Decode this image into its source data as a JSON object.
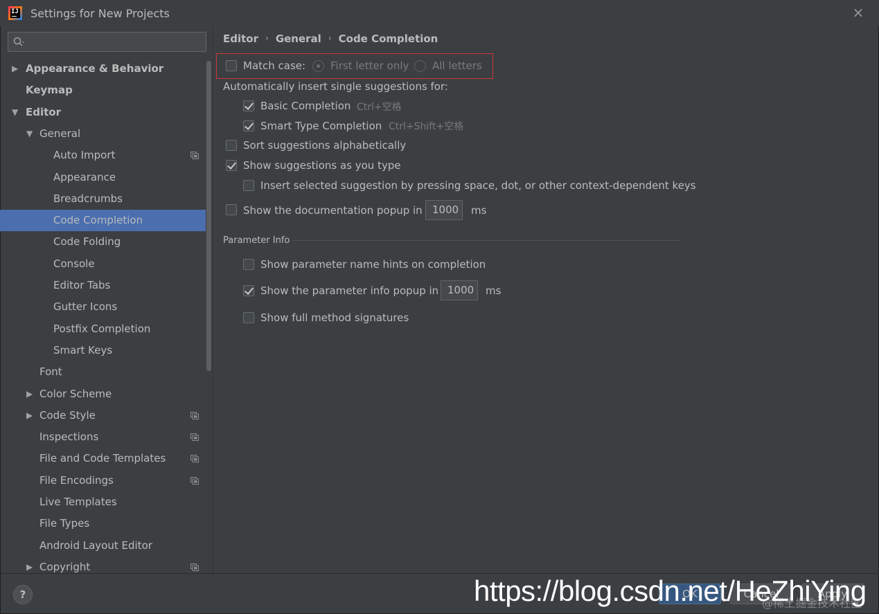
{
  "window": {
    "title": "Settings for New Projects",
    "close_icon": "×"
  },
  "search": {
    "placeholder": ""
  },
  "tree": [
    {
      "label": "Appearance & Behavior",
      "bold": true,
      "arrow": "▶",
      "indent": 0
    },
    {
      "label": "Keymap",
      "bold": true,
      "arrow": "",
      "indent": 0
    },
    {
      "label": "Editor",
      "bold": true,
      "arrow": "▼",
      "indent": 0
    },
    {
      "label": "General",
      "bold": false,
      "arrow": "▼",
      "indent": 1
    },
    {
      "label": "Auto Import",
      "bold": false,
      "arrow": "",
      "indent": 2,
      "project_icon": true
    },
    {
      "label": "Appearance",
      "bold": false,
      "arrow": "",
      "indent": 2
    },
    {
      "label": "Breadcrumbs",
      "bold": false,
      "arrow": "",
      "indent": 2
    },
    {
      "label": "Code Completion",
      "bold": false,
      "arrow": "",
      "indent": 2,
      "selected": true
    },
    {
      "label": "Code Folding",
      "bold": false,
      "arrow": "",
      "indent": 2
    },
    {
      "label": "Console",
      "bold": false,
      "arrow": "",
      "indent": 2
    },
    {
      "label": "Editor Tabs",
      "bold": false,
      "arrow": "",
      "indent": 2
    },
    {
      "label": "Gutter Icons",
      "bold": false,
      "arrow": "",
      "indent": 2
    },
    {
      "label": "Postfix Completion",
      "bold": false,
      "arrow": "",
      "indent": 2
    },
    {
      "label": "Smart Keys",
      "bold": false,
      "arrow": "",
      "indent": 2
    },
    {
      "label": "Font",
      "bold": false,
      "arrow": "",
      "indent": 1
    },
    {
      "label": "Color Scheme",
      "bold": false,
      "arrow": "▶",
      "indent": 1
    },
    {
      "label": "Code Style",
      "bold": false,
      "arrow": "▶",
      "indent": 1,
      "project_icon": true
    },
    {
      "label": "Inspections",
      "bold": false,
      "arrow": "",
      "indent": 1,
      "project_icon": true
    },
    {
      "label": "File and Code Templates",
      "bold": false,
      "arrow": "",
      "indent": 1,
      "project_icon": true
    },
    {
      "label": "File Encodings",
      "bold": false,
      "arrow": "",
      "indent": 1,
      "project_icon": true
    },
    {
      "label": "Live Templates",
      "bold": false,
      "arrow": "",
      "indent": 1
    },
    {
      "label": "File Types",
      "bold": false,
      "arrow": "",
      "indent": 1
    },
    {
      "label": "Android Layout Editor",
      "bold": false,
      "arrow": "",
      "indent": 1
    },
    {
      "label": "Copyright",
      "bold": false,
      "arrow": "▶",
      "indent": 1,
      "project_icon": true
    }
  ],
  "breadcrumb": {
    "items": [
      "Editor",
      "General",
      "Code Completion"
    ],
    "separator": "›"
  },
  "match_case": {
    "label": "Match case:",
    "checked": false,
    "radio_first": "First letter only",
    "radio_all": "All letters",
    "selected": "first"
  },
  "auto_insert": {
    "heading": "Automatically insert single suggestions for:",
    "basic": {
      "label": "Basic Completion",
      "shortcut": "Ctrl+空格",
      "checked": true
    },
    "smart": {
      "label": "Smart Type Completion",
      "shortcut": "Ctrl+Shift+空格",
      "checked": true
    }
  },
  "options": {
    "sort_alpha": {
      "label": "Sort suggestions alphabetically",
      "checked": false
    },
    "show_as_type": {
      "label": "Show suggestions as you type",
      "checked": true
    },
    "insert_selected": {
      "label": "Insert selected suggestion by pressing space, dot, or other context-dependent keys",
      "checked": false
    },
    "doc_popup": {
      "label": "Show the documentation popup in",
      "value": "1000",
      "unit": "ms",
      "checked": false
    }
  },
  "parameter_info": {
    "title": "Parameter Info",
    "name_hints": {
      "label": "Show parameter name hints on completion",
      "checked": false
    },
    "info_popup": {
      "label": "Show the parameter info popup in",
      "value": "1000",
      "unit": "ms",
      "checked": true
    },
    "full_signatures": {
      "label": "Show full method signatures",
      "checked": false
    }
  },
  "footer": {
    "help_label": "?",
    "ok_label": "OK",
    "cancel_label": "Cancel",
    "apply_label": "Apply"
  },
  "watermark": {
    "url": "https://blog.csdn.net/HeZhiYing",
    "community": "@稀土掘金技术社区"
  },
  "colors": {
    "background": "#3c3f41",
    "selection": "#4b6eaf",
    "highlight_border": "#d0343a",
    "text": "#bbbbbb"
  }
}
